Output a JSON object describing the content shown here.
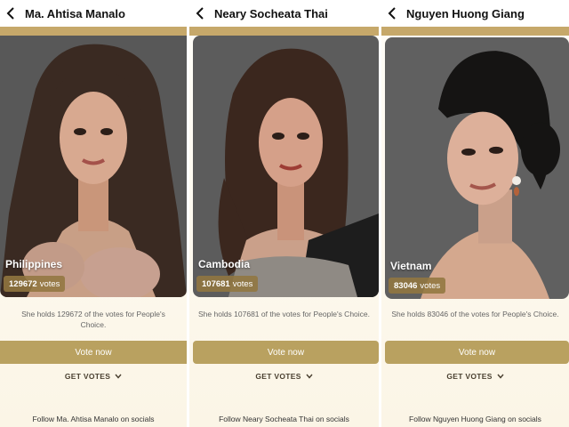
{
  "follow_label": "Follow",
  "follow_suffix": "on socials",
  "votes_unit": "votes",
  "vote_button_label": "Vote now",
  "get_votes_label": "GET VOTES",
  "colors": {
    "gold": "#c6a86a",
    "vote_button": "#b9a160",
    "vote_pill": "#927640",
    "card_background": "#5a5a5a"
  },
  "icons": {
    "back": "chevron-left-icon",
    "expand": "chevron-down-icon"
  },
  "contestants": [
    {
      "name": "Ma. Ahtisa Manalo",
      "country": "Philippines",
      "votes": "129672",
      "description": "She holds 129672 of the votes for People's Choice."
    },
    {
      "name": "Neary Socheata Thai",
      "country": "Cambodia",
      "votes": "107681",
      "description": "She holds 107681 of the votes for People's Choice."
    },
    {
      "name": "Nguyen Huong Giang",
      "country": "Vietnam",
      "votes": "83046",
      "description": "She holds 83046 of the votes for People's Choice."
    }
  ]
}
